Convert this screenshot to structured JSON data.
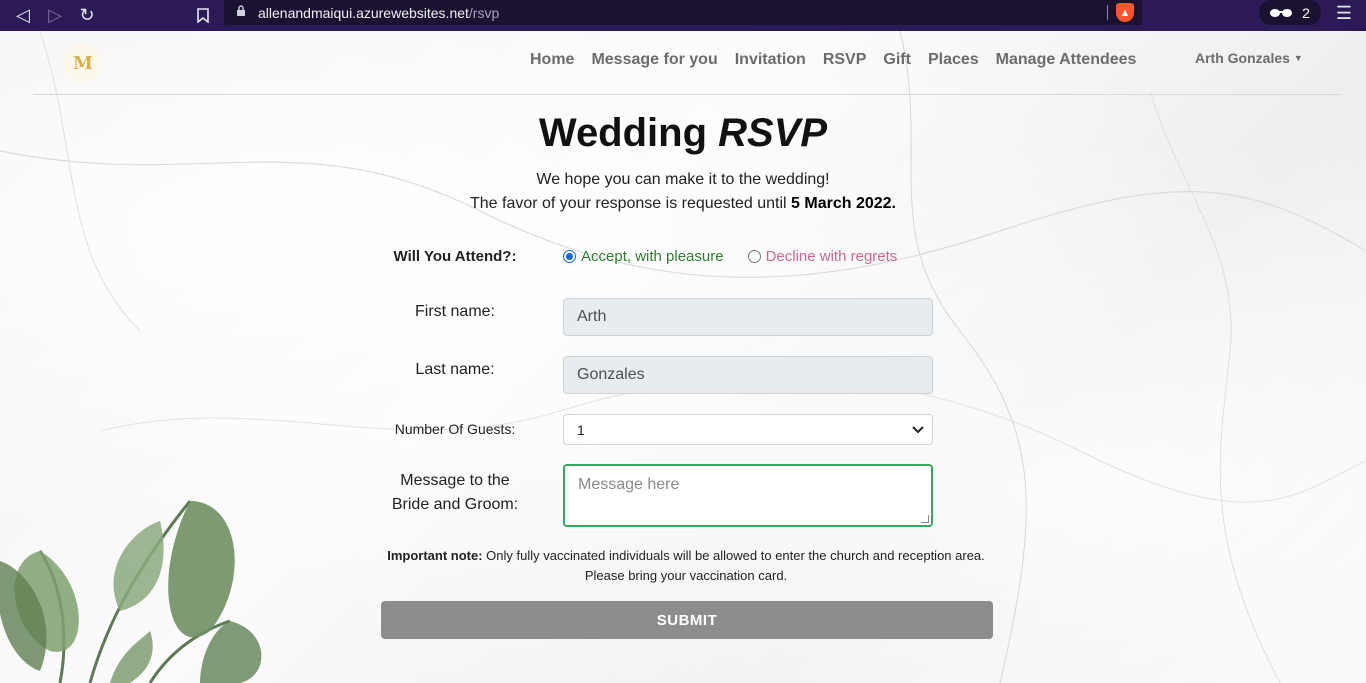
{
  "browser": {
    "url_host": "allenandmaiqui.azurewebsites.net",
    "url_path": "/rsvp",
    "extension_count": "2",
    "icons": [
      "back-icon",
      "forward-icon",
      "reload-icon",
      "bookmark-icon",
      "lock-icon",
      "brave-shield-icon",
      "glasses-icon",
      "menu-icon"
    ]
  },
  "nav": {
    "logo_text": "M",
    "links": [
      "Home",
      "Message for you",
      "Invitation",
      "RSVP",
      "Gift",
      "Places",
      "Manage Attendees"
    ],
    "user": "Arth Gonzales"
  },
  "header": {
    "title_plain": "Wedding ",
    "title_italic": "RSVP",
    "subtitle": "We hope you can make it to the wedding!",
    "deadline_prefix": "The favor of your response is requested until ",
    "deadline_date": "5 March 2022."
  },
  "form": {
    "attend_label": "Will You Attend?:",
    "accept_label": "Accept, with pleasure",
    "decline_label": "Decline with regrets",
    "selected": "accept",
    "first_name_label": "First name:",
    "first_name_value": "Arth",
    "last_name_label": "Last name:",
    "last_name_value": "Gonzales",
    "guests_label": "Number Of Guests:",
    "guests_value": "1",
    "message_label_line1": "Message to the",
    "message_label_line2": "Bride and Groom:",
    "message_placeholder": "Message here",
    "note_bold": "Important note:",
    "note_text": " Only fully vaccinated individuals will be allowed to enter the church and reception area.",
    "note_line2": "Please bring your vaccination card.",
    "submit_label": "SUBMIT"
  },
  "colors": {
    "browser_bar": "#2b1a55",
    "accept": "#2e7d32",
    "decline": "#d06a86",
    "radio_selected": "#0b6bdc",
    "submit_bg": "#8d8d8d",
    "message_border": "#3aa85a"
  }
}
